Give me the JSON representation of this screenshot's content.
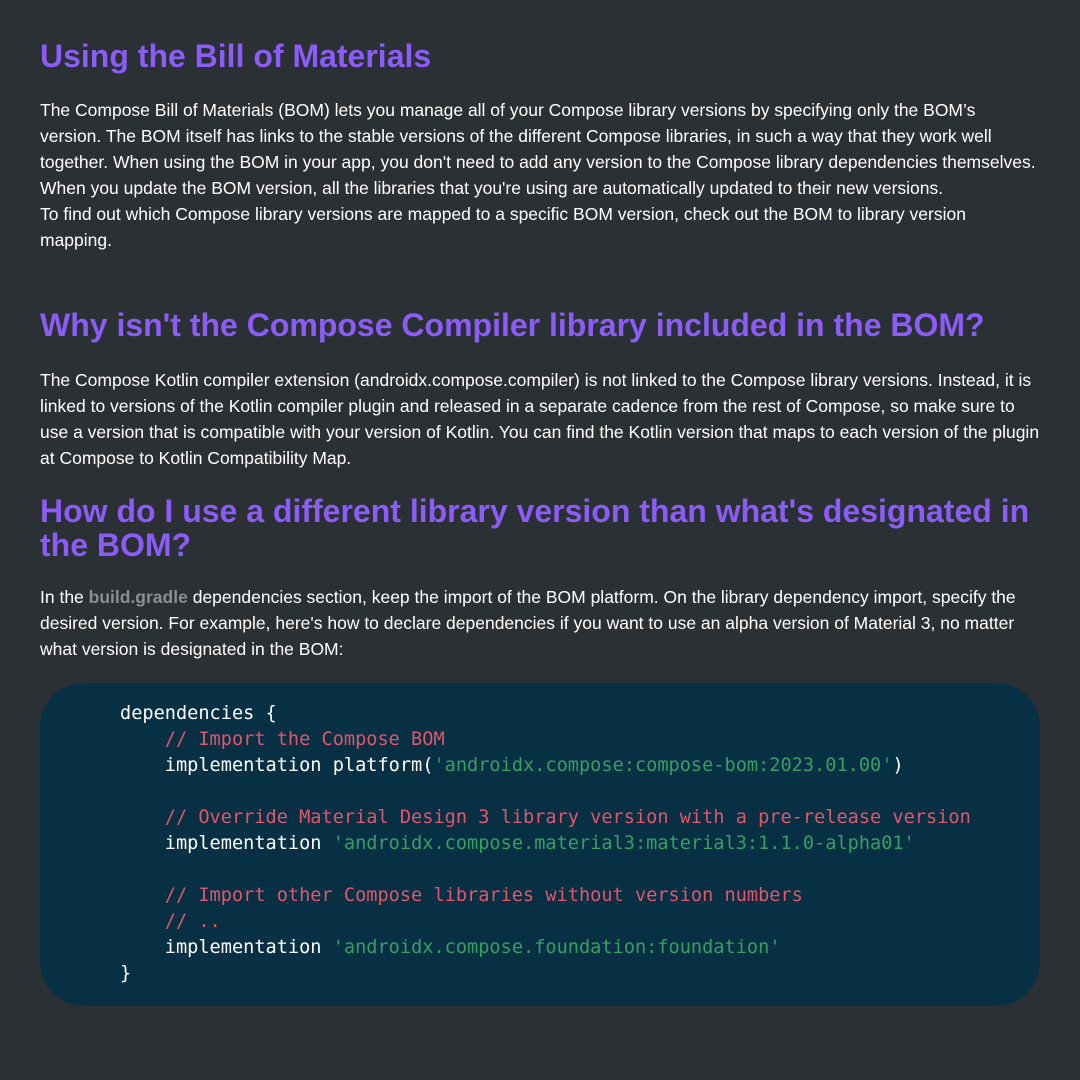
{
  "section1": {
    "heading": "Using the Bill of Materials",
    "paragraph": "The Compose Bill of Materials (BOM) lets you manage all of your Compose library versions by specifying only the BOM’s version. The BOM itself has links to the stable versions of the different Compose libraries, in such a way that they work well together. When using the BOM in your app, you don't need to add any version to the Compose library dependencies themselves. When you update the BOM version, all the libraries that you're using are automatically updated to their new versions.\nTo find out which Compose library versions are mapped to a specific BOM version, check out the BOM to library version mapping."
  },
  "section2": {
    "heading": "Why isn't the Compose Compiler library included in the BOM?",
    "paragraph": "The Compose Kotlin compiler extension (androidx.compose.compiler) is not linked to the Compose library versions. Instead, it is linked to versions of the Kotlin compiler plugin and released in a separate cadence from the rest of Compose, so make sure to use a version that is compatible with your version of Kotlin. You can find the Kotlin version that maps to each version of the plugin at Compose to Kotlin Compatibility Map."
  },
  "section3": {
    "heading": "How do I use a different library version than what's designated in the BOM?",
    "paragraph_before": "In the ",
    "inline_code": "build.gradle",
    "paragraph_after": " dependencies section, keep the import of the BOM platform. On the library dependency import, specify the desired version. For example, here's how to declare dependencies if you want to use an alpha version of Material 3, no matter what version is designated in the BOM:"
  },
  "code": {
    "line1": "dependencies {",
    "comment1": "// Import the Compose BOM",
    "impl1": "implementation platform(",
    "str1": "'androidx.compose:compose-bom:2023.01.00'",
    "close1": ")",
    "comment2": "// Override Material Design 3 library version with a pre-release version",
    "impl2": "implementation ",
    "str2": "'androidx.compose.material3:material3:1.1.0-alpha01'",
    "comment3": "// Import other Compose libraries without version numbers",
    "comment4": "// ..",
    "impl3": "implementation ",
    "str3": "'androidx.compose.foundation:foundation'",
    "closing": "}"
  },
  "colors": {
    "background": "#2a3034",
    "heading": "#8b5cf6",
    "code_background": "#083044",
    "code_comment": "#e0566a",
    "code_string": "#34a064",
    "inline_code": "#8a8f92"
  }
}
